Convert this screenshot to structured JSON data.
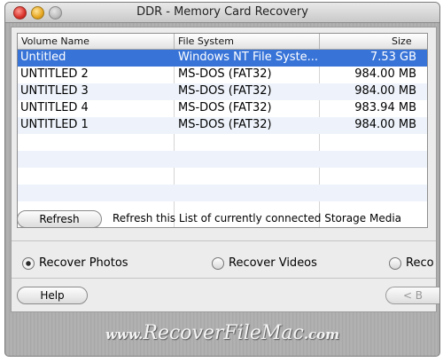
{
  "window": {
    "title": "DDR - Memory Card Recovery"
  },
  "table": {
    "columns": [
      "Volume Name",
      "File System",
      "Size"
    ],
    "rows": [
      {
        "name": "Untitled",
        "fs": "Windows NT File Syste...",
        "size": "7.53  GB"
      },
      {
        "name": "UNTITLED 2",
        "fs": "MS-DOS (FAT32)",
        "size": "984.00  MB"
      },
      {
        "name": "UNTITLED 3",
        "fs": "MS-DOS (FAT32)",
        "size": "984.00  MB"
      },
      {
        "name": "UNTITLED 4",
        "fs": "MS-DOS (FAT32)",
        "size": "983.94  MB"
      },
      {
        "name": "UNTITLED 1",
        "fs": "MS-DOS (FAT32)",
        "size": "984.00  MB"
      }
    ]
  },
  "refresh": {
    "label": "Refresh",
    "note": "Refresh this List of currently connected Storage Media"
  },
  "options": [
    {
      "label": "Recover Photos",
      "selected": true
    },
    {
      "label": "Recover Videos",
      "selected": false
    },
    {
      "label": "Reco",
      "selected": false
    }
  ],
  "help": {
    "label": "Help"
  },
  "next": {
    "label": "< B"
  },
  "banner": {
    "prefix": "www.",
    "name": "RecoverFileMac",
    "suffix": ".com"
  },
  "colors": {
    "selection": "#3874d8"
  }
}
